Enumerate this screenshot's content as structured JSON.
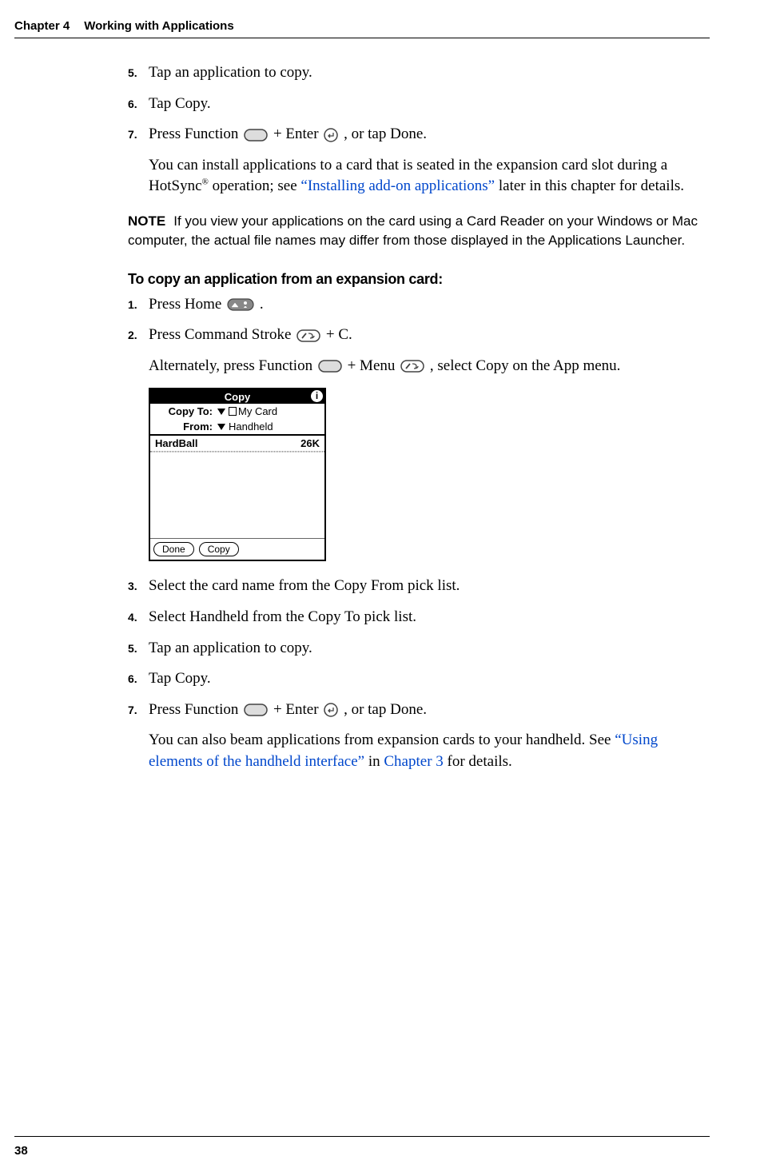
{
  "header": {
    "chapter": "Chapter 4",
    "title": "Working with Applications"
  },
  "first_list": {
    "item5": {
      "num": "5.",
      "text": "Tap an application to copy."
    },
    "item6": {
      "num": "6.",
      "text": "Tap Copy."
    },
    "item7": {
      "num": "7.",
      "prefix": "Press Function ",
      "mid": " + Enter ",
      "suffix": ", or tap Done.",
      "para1a": "You can install applications to a card that is seated in the expansion card slot during a HotSync",
      "reg": "®",
      "para1b": " operation; see ",
      "link": "“Installing add-on applications”",
      "para1c": " later in this chapter for details."
    }
  },
  "note": {
    "label": "NOTE",
    "text": "If you view your applications on the card using a Card Reader on your Windows or Mac computer, the actual file names may differ from those displayed in the Applications Launcher."
  },
  "subhead": "To copy an application from an expansion card:",
  "second_list": {
    "item1": {
      "num": "1.",
      "prefix": "Press Home ",
      "suffix": "."
    },
    "item2": {
      "num": "2.",
      "prefix": "Press Command Stroke ",
      "suffix": " + C.",
      "alt_prefix": "Alternately, press Function ",
      "alt_mid": " + Menu ",
      "alt_suffix": ", select Copy on the App menu."
    },
    "item3": {
      "num": "3.",
      "text": "Select the card name from the Copy From pick list."
    },
    "item4": {
      "num": "4.",
      "text": "Select Handheld from the Copy To pick list."
    },
    "item5": {
      "num": "5.",
      "text": "Tap an application to copy."
    },
    "item6": {
      "num": "6.",
      "text": "Tap Copy."
    },
    "item7": {
      "num": "7.",
      "prefix": "Press Function ",
      "mid": " + Enter ",
      "suffix": ", or tap Done.",
      "para_a": "You can also beam applications from expansion cards to your handheld. See ",
      "link1": "“Using elements of the handheld interface”",
      "between": " in ",
      "link2": "Chapter 3",
      "para_b": " for details."
    }
  },
  "screenshot": {
    "title": "Copy",
    "info": "i",
    "copy_to_label": "Copy To:",
    "copy_to_value": "My Card",
    "from_label": "From:",
    "from_value": "Handheld",
    "app_name": "HardBall",
    "app_size": "26K",
    "done": "Done",
    "copy": "Copy"
  },
  "page_number": "38"
}
